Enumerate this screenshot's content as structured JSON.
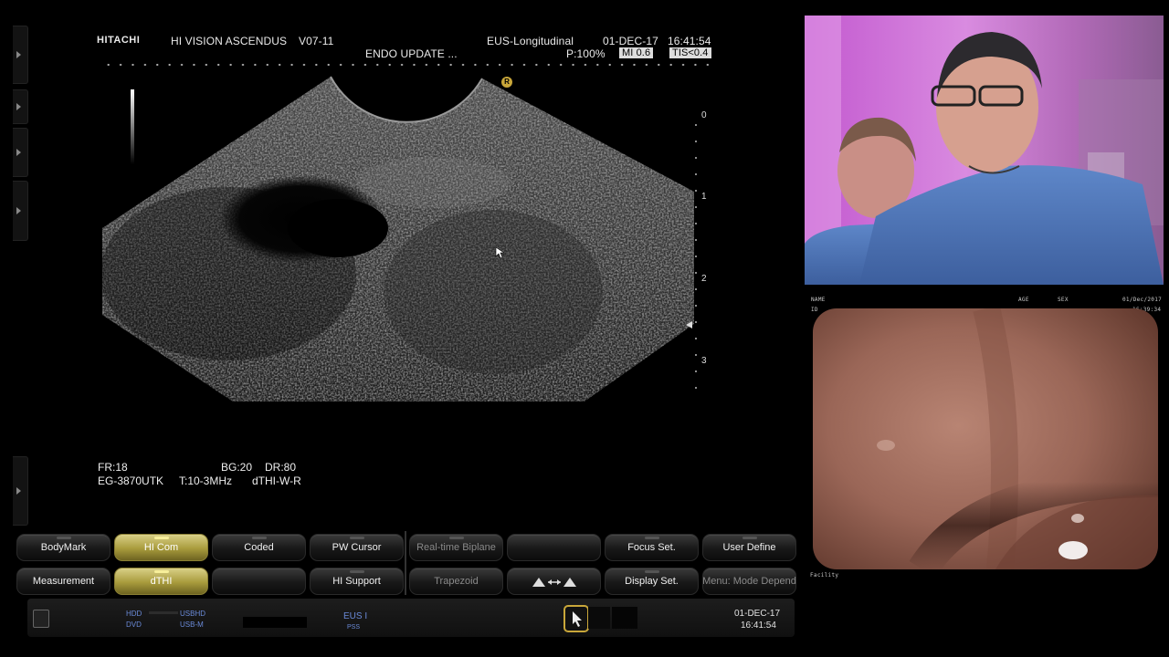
{
  "header": {
    "brand": "HITACHI",
    "system": "HI VISION ASCENDUS",
    "version": "V07-11",
    "study": "ENDO UPDATE ...",
    "mode": "EUS-Longitudinal",
    "date": "01-DEC-17",
    "time": "16:41:54",
    "power": "P:100%",
    "mi": "MI 0.6",
    "tis": "TIS<0.4"
  },
  "depth_scale": [
    "0",
    "1",
    "2",
    "3"
  ],
  "focus_marker": "R",
  "info": {
    "fr": "FR:18",
    "bg": "BG:20",
    "dr": "DR:80",
    "probe": "EG-3870UTK",
    "freq": "T:10-3MHz",
    "thi": "dTHI-W-R"
  },
  "buttons_row1": [
    {
      "label": "BodyMark",
      "state": "normal"
    },
    {
      "label": "HI Com",
      "state": "on"
    },
    {
      "label": "Coded",
      "state": "normal"
    },
    {
      "label": "PW Cursor",
      "state": "normal"
    },
    {
      "label": "Real-time Biplane",
      "state": "dim"
    },
    {
      "label": "",
      "state": "dim"
    },
    {
      "label": "Focus Set.",
      "state": "normal"
    },
    {
      "label": "User Define",
      "state": "normal"
    }
  ],
  "buttons_row2": [
    {
      "label": "Measurement",
      "state": "normal"
    },
    {
      "label": "dTHI",
      "state": "on"
    },
    {
      "label": "",
      "state": "normal"
    },
    {
      "label": "HI Support",
      "state": "normal"
    },
    {
      "label": "Trapezoid",
      "state": "dim"
    },
    {
      "label": "",
      "state": "normal"
    },
    {
      "label": "Display Set.",
      "state": "normal"
    },
    {
      "label": "Menu: Mode Depend",
      "state": "dim"
    }
  ],
  "status": {
    "hdd": "HDD",
    "usbhd": "USBHD",
    "dvd": "DVD",
    "usbm": "USB-M",
    "eus": "EUS I",
    "pss": "PSS",
    "date": "01-DEC-17",
    "time": "16:41:54"
  },
  "endo_overlay": {
    "name": "NAME",
    "age": "AGE",
    "sex": "SEX",
    "date": "01/Dec/2017",
    "id": "ID",
    "time": "16:39:34",
    "facility": "Facility"
  },
  "colors": {
    "active_button": "#a89b3c",
    "status_text": "#6a8ad8",
    "background": "#000000"
  }
}
